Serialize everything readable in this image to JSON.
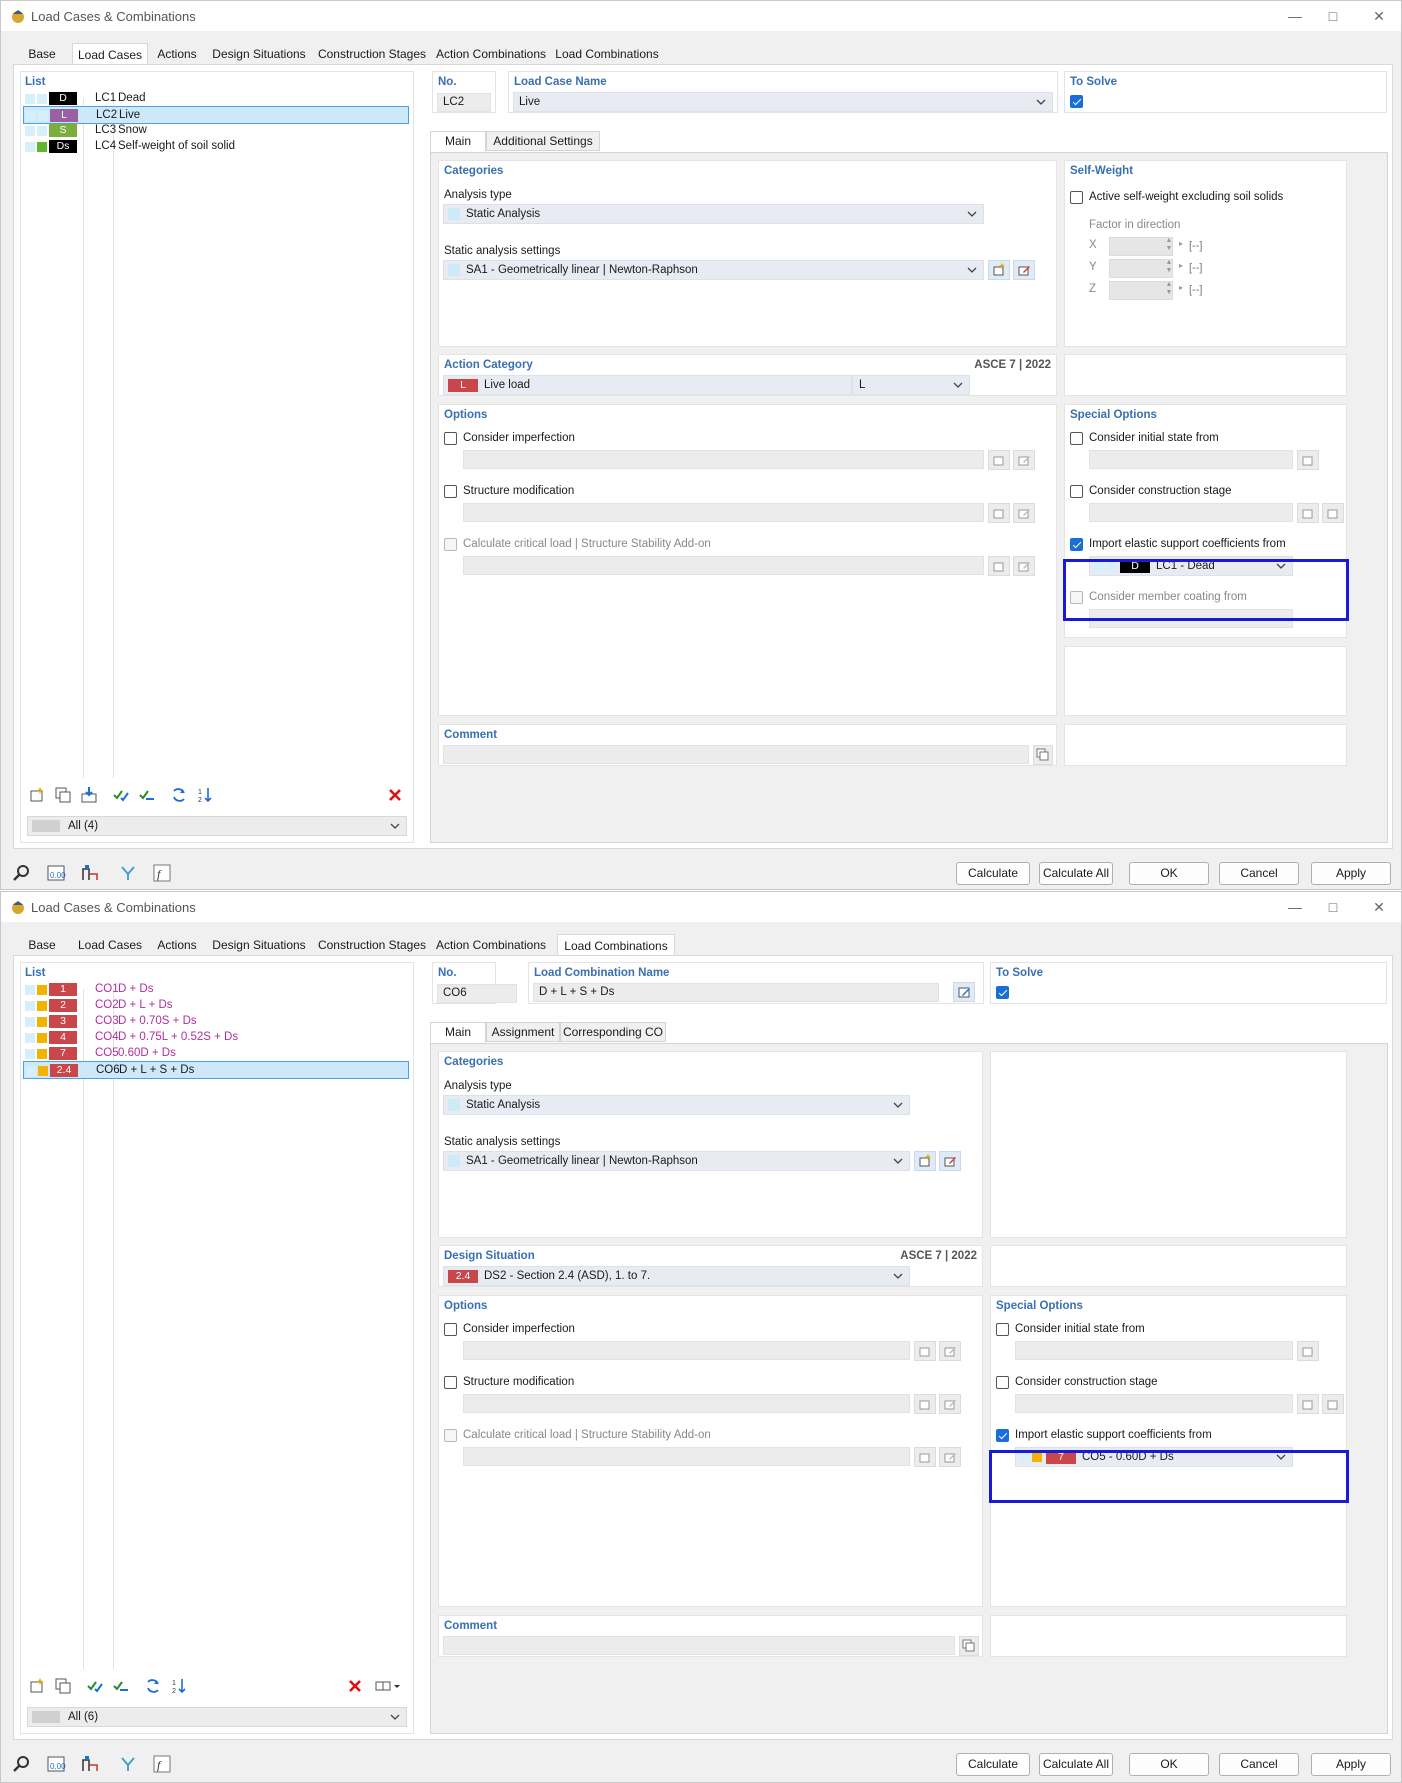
{
  "colors": {
    "accent_blue": "#3a6fb0",
    "highlight_frame": "#1a1ad6",
    "selection_bg": "#cde8f9",
    "check_blue": "#1a6fd6"
  },
  "window1": {
    "title": "Load Cases & Combinations",
    "tabs": [
      "Base",
      "Load Cases",
      "Actions",
      "Design Situations",
      "Construction Stages",
      "Action Combinations",
      "Load Combinations"
    ],
    "active_tab": "Load Cases",
    "list_title": "List",
    "list": [
      {
        "badge": "D",
        "badge_color": "#000000",
        "sq1": "#d6f0fb",
        "sq2": "#d6f0fb",
        "no": "LC1",
        "name": "Dead"
      },
      {
        "badge": "L",
        "badge_color": "#9b5fa3",
        "sq1": "#d6f0fb",
        "sq2": "#d6f0fb",
        "no": "LC2",
        "name": "Live"
      },
      {
        "badge": "S",
        "badge_color": "#7cae3c",
        "sq1": "#d6f0fb",
        "sq2": "#d6f0fb",
        "no": "LC3",
        "name": "Snow"
      },
      {
        "badge": "Ds",
        "badge_color": "#000000",
        "sq1": "#d6f0fb",
        "sq2": "#5db830",
        "no": "LC4",
        "name": "Self-weight of soil solid"
      }
    ],
    "filter": "All (4)",
    "no_label": "No.",
    "no_value": "LC2",
    "name_label": "Load Case Name",
    "name_value": "Live",
    "to_solve_label": "To Solve",
    "subtabs": [
      "Main",
      "Additional Settings"
    ],
    "categories_title": "Categories",
    "analysis_type_label": "Analysis type",
    "analysis_type_value": "Static Analysis",
    "static_settings_label": "Static analysis settings",
    "static_settings_value": "SA1 - Geometrically linear | Newton-Raphson",
    "self_weight_title": "Self-Weight",
    "self_weight_check": "Active self-weight excluding soil solids",
    "factor_label": "Factor in direction",
    "factor_axes": [
      "X",
      "Y",
      "Z"
    ],
    "factor_unit": "[--]",
    "action_category_title": "Action Category",
    "standard": "ASCE 7 | 2022",
    "action_badge": "L",
    "action_value": "Live load",
    "action_code": "L",
    "options_title": "Options",
    "opt_imperfection": "Consider imperfection",
    "opt_modification": "Structure modification",
    "opt_critical": "Calculate critical load | Structure Stability Add-on",
    "special_title": "Special Options",
    "sp_initial": "Consider initial state from",
    "sp_construction": "Consider construction stage",
    "sp_import": "Import elastic support coefficients from",
    "sp_import_badge": "D",
    "sp_import_value": "LC1 - Dead",
    "sp_coating": "Consider member coating from",
    "comment_title": "Comment"
  },
  "window2": {
    "title": "Load Cases & Combinations",
    "tabs": [
      "Base",
      "Load Cases",
      "Actions",
      "Design Situations",
      "Construction Stages",
      "Action Combinations",
      "Load Combinations"
    ],
    "active_tab": "Load Combinations",
    "list_title": "List",
    "list": [
      {
        "badge": "1",
        "badge_color": "#c9464a",
        "no": "CO1",
        "name": "D + Ds"
      },
      {
        "badge": "2",
        "badge_color": "#c9464a",
        "no": "CO2",
        "name": "D + L + Ds"
      },
      {
        "badge": "3",
        "badge_color": "#c9464a",
        "no": "CO3",
        "name": "D + 0.70S + Ds"
      },
      {
        "badge": "4",
        "badge_color": "#c9464a",
        "no": "CO4",
        "name": "D + 0.75L + 0.52S + Ds"
      },
      {
        "badge": "7",
        "badge_color": "#c9464a",
        "no": "CO5",
        "name": "0.60D + Ds"
      },
      {
        "badge": "2.4",
        "badge_color": "#c9464a",
        "no": "CO6",
        "name": "D + L + S + Ds"
      }
    ],
    "filter": "All (6)",
    "no_label": "No.",
    "no_value": "CO6",
    "name_label": "Load Combination Name",
    "name_value": "D + L + S + Ds",
    "to_solve_label": "To Solve",
    "subtabs": [
      "Main",
      "Assignment",
      "Corresponding CO"
    ],
    "categories_title": "Categories",
    "analysis_type_label": "Analysis type",
    "analysis_type_value": "Static Analysis",
    "static_settings_label": "Static analysis settings",
    "static_settings_value": "SA1 - Geometrically linear | Newton-Raphson",
    "design_situation_title": "Design Situation",
    "standard": "ASCE 7 | 2022",
    "ds_badge": "2.4",
    "ds_value": "DS2 - Section 2.4 (ASD), 1. to 7.",
    "options_title": "Options",
    "opt_imperfection": "Consider imperfection",
    "opt_modification": "Structure modification",
    "opt_critical": "Calculate critical load | Structure Stability Add-on",
    "special_title": "Special Options",
    "sp_initial": "Consider initial state from",
    "sp_construction": "Consider construction stage",
    "sp_import": "Import elastic support coefficients from",
    "sp_import_badge": "7",
    "sp_import_value": "CO5 - 0.60D + Ds",
    "comment_title": "Comment"
  },
  "buttons": {
    "calculate": "Calculate",
    "calculate_all": "Calculate All",
    "ok": "OK",
    "cancel": "Cancel",
    "apply": "Apply"
  },
  "bottom_icons": [
    "search-icon",
    "units-icon",
    "model-icon",
    "filter-icon",
    "formula-icon"
  ]
}
